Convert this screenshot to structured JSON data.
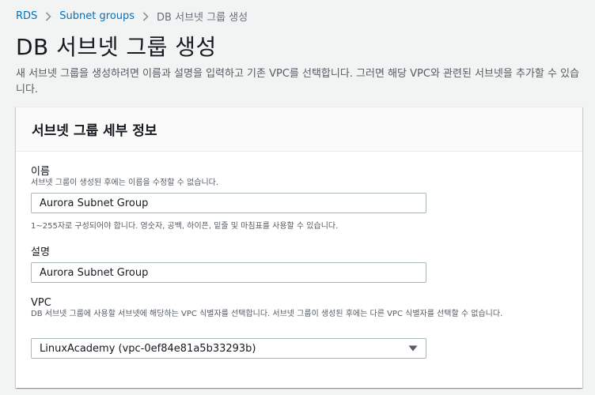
{
  "breadcrumb": {
    "items": [
      "RDS",
      "Subnet groups",
      "DB 서브넷 그룹 생성"
    ]
  },
  "page": {
    "title": "DB 서브넷 그룹 생성",
    "description": "새 서브넷 그룹을 생성하려면 이름과 설명을 입력하고 기존 VPC를 선택합니다. 그러면 해당 VPC와 관련된 서브넷을 추가할 수 있습니다."
  },
  "panel": {
    "title": "서브넷 그룹 세부 정보"
  },
  "form": {
    "name": {
      "label": "이름",
      "description": "서브넷 그룹이 생성된 후에는 이름을 수정할 수 없습니다.",
      "value": "Aurora Subnet Group",
      "constraint": "1~255자로 구성되어야 합니다. 영숫자, 공백, 하이픈, 밑줄 및 마침표를 사용할 수 있습니다."
    },
    "description": {
      "label": "설명",
      "value": "Aurora Subnet Group"
    },
    "vpc": {
      "label": "VPC",
      "description": "DB 서브넷 그룹에 사용할 서브넷에 해당하는 VPC 식별자를 선택합니다. 서브넷 그룹이 생성된 후에는 다른 VPC 식별자를 선택할 수 없습니다.",
      "selected": "LinuxAcademy (vpc-0ef84e81a5b33293b)"
    }
  },
  "colors": {
    "link": "#0073bb",
    "background": "#f2f3f3",
    "panel_header": "#fafafa"
  },
  "icons": {
    "breadcrumb_separator": "chevron-right-icon",
    "select_caret": "caret-down-icon"
  }
}
